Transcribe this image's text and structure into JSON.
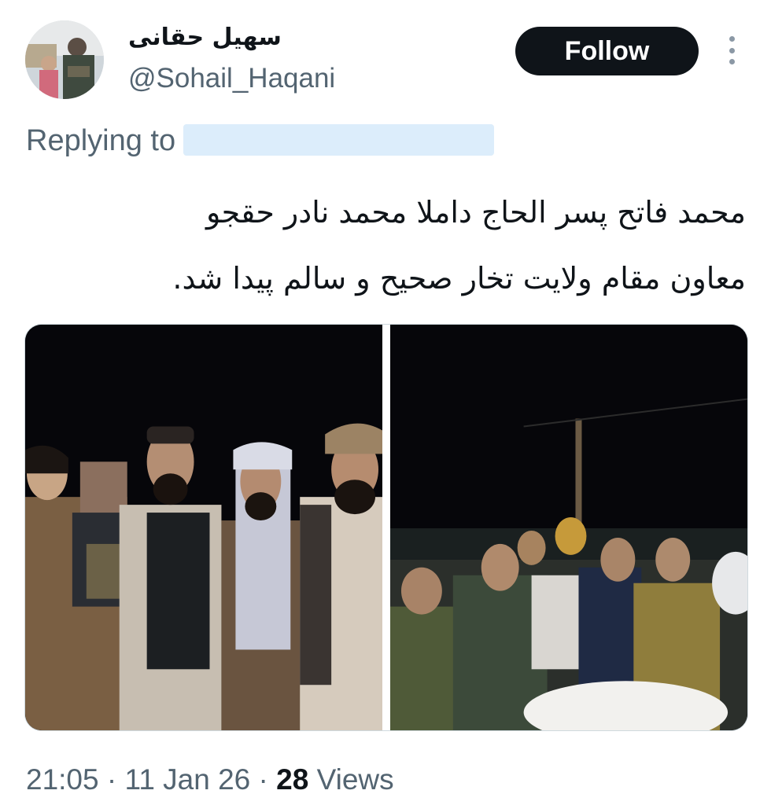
{
  "author": {
    "display_name": "سهیل حقانی",
    "handle": "@Sohail_Haqani",
    "avatar_icon": "profile-photo"
  },
  "follow_label": "Follow",
  "more_icon": "more-vertical-icon",
  "reply": {
    "prefix": "Replying to"
  },
  "tweet": {
    "line1": "محمد فاتح پسر الحاج داملا محمد نادر حقجو",
    "line2": "معاون مقام ولایت تخار صحیح و سالم پیدا شد."
  },
  "media": {
    "count": 2
  },
  "meta": {
    "time": "21:05",
    "separator": "·",
    "date": "11 Jan 26",
    "views_count": "28",
    "views_label": "Views"
  },
  "colors": {
    "text": "#0f1419",
    "secondary": "#536471",
    "follow_bg": "#0f1419",
    "mention_redaction": "#dcedfb"
  }
}
